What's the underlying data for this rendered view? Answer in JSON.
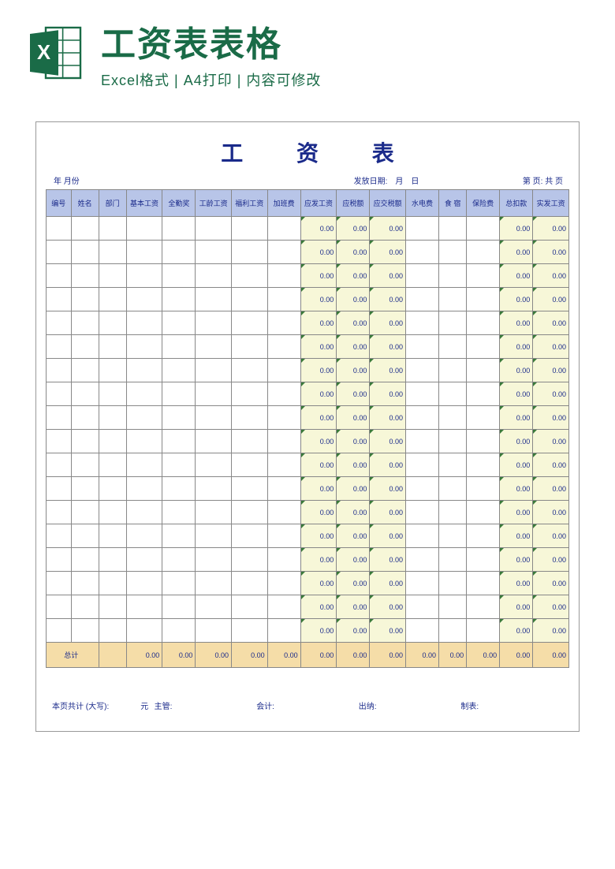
{
  "header": {
    "title": "工资表表格",
    "subtitle": "Excel格式 | A4打印 | 内容可修改"
  },
  "sheet": {
    "title": "工 资 表",
    "meta": {
      "period": "年 月份",
      "pay_date": "发放日期:　月　日",
      "page": "第 页: 共 页"
    },
    "columns": [
      "编号",
      "姓名",
      "部门",
      "基本工资",
      "全勤奖",
      "工龄工资",
      "福利工资",
      "加班费",
      "应发工资",
      "应税额",
      "应交税额",
      "水电费",
      "食 宿",
      "保险费",
      "总扣款",
      "实发工资"
    ],
    "calc_cols": [
      8,
      9,
      10,
      14,
      15
    ],
    "row_count": 18,
    "cell_value": "0.00",
    "total": {
      "label": "总计",
      "values": [
        "",
        "0.00",
        "0.00",
        "0.00",
        "0.00",
        "0.00",
        "0.00",
        "0.00",
        "0.00",
        "0.00",
        "0.00",
        "0.00",
        "0.00",
        "0.00"
      ]
    },
    "footer": {
      "amount_words": "本页共计 (大写):",
      "currency": "元",
      "supervisor": "主管:",
      "accountant": "会计:",
      "cashier": "出纳:",
      "maker": "制表:"
    }
  }
}
